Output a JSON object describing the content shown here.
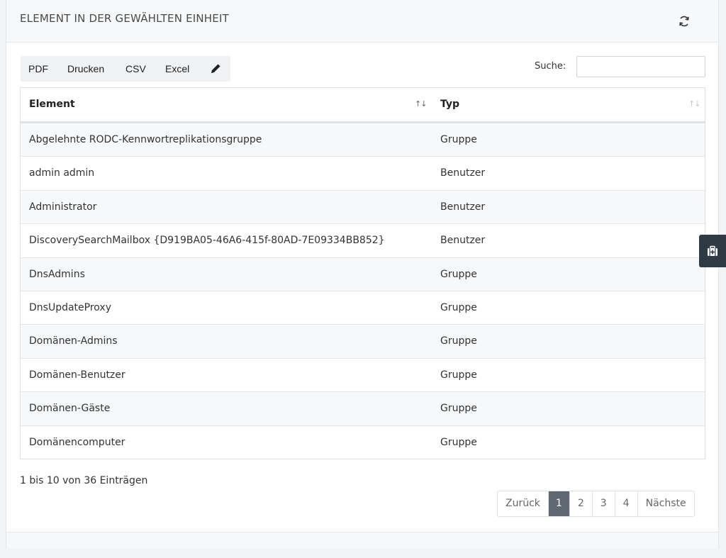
{
  "header": {
    "title": "ELEMENT IN DER GEWÄHLTEN EINHEIT",
    "refresh_icon": "refresh-icon"
  },
  "toolbar": {
    "pdf": "PDF",
    "print": "Drucken",
    "csv": "CSV",
    "excel": "Excel",
    "edit_icon": "pencil-icon"
  },
  "search": {
    "label": "Suche:",
    "value": "",
    "placeholder": ""
  },
  "table": {
    "columns": [
      "Element",
      "Typ"
    ],
    "rows": [
      {
        "element": "Abgelehnte RODC-Kennwortreplikationsgruppe",
        "typ": "Gruppe"
      },
      {
        "element": "admin admin",
        "typ": "Benutzer"
      },
      {
        "element": "Administrator",
        "typ": "Benutzer"
      },
      {
        "element": "DiscoverySearchMailbox {D919BA05-46A6-415f-80AD-7E09334BB852}",
        "typ": "Benutzer"
      },
      {
        "element": "DnsAdmins",
        "typ": "Gruppe"
      },
      {
        "element": "DnsUpdateProxy",
        "typ": "Gruppe"
      },
      {
        "element": "Domänen-Admins",
        "typ": "Gruppe"
      },
      {
        "element": "Domänen-Benutzer",
        "typ": "Gruppe"
      },
      {
        "element": "Domänen-Gäste",
        "typ": "Gruppe"
      },
      {
        "element": "Domänencomputer",
        "typ": "Gruppe"
      }
    ]
  },
  "info": "1 bis 10 von 36 Einträgen",
  "pagination": {
    "previous": "Zurück",
    "pages": [
      "1",
      "2",
      "3",
      "4"
    ],
    "active": "1",
    "next": "Nächste"
  },
  "side_widget_icon": "medkit-icon",
  "colors": {
    "active_page": "#5f6870",
    "side_widget": "#2f3b44",
    "stripe": "#f7f8f9"
  }
}
